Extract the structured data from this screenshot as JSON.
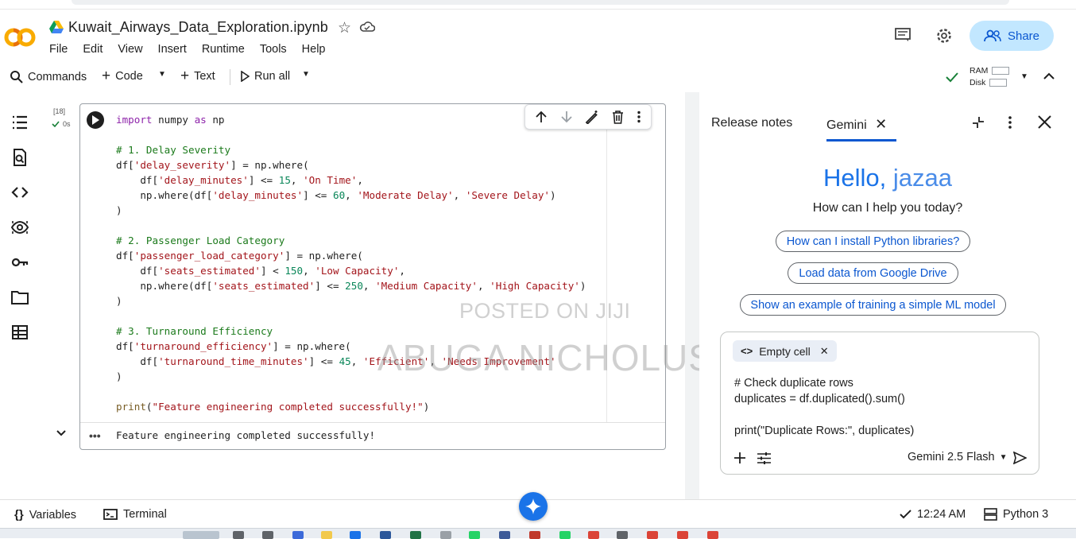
{
  "header": {
    "title": "Kuwait_Airways_Data_Exploration.ipynb",
    "menu": [
      "File",
      "Edit",
      "View",
      "Insert",
      "Runtime",
      "Tools",
      "Help"
    ],
    "share_label": "Share",
    "logo_text": "CO"
  },
  "toolbar": {
    "commands_label": "Commands",
    "code_label": "Code",
    "text_label": "Text",
    "run_all_label": "Run all",
    "ram_label": "RAM",
    "disk_label": "Disk"
  },
  "cell": {
    "exec_count": "[18]",
    "exec_time": "0s",
    "output": "Feature engineering completed successfully!",
    "output_dots": "•••"
  },
  "watermark": {
    "line1": "POSTED ON JIJI",
    "line2": "ABUGA NICHOLUS"
  },
  "panel": {
    "tab_release": "Release notes",
    "tab_gemini": "Gemini",
    "greeting_hello": "Hello,",
    "greeting_name": "jazaa",
    "help_question": "How can I help you today?",
    "suggestions": [
      "How can I install Python libraries?",
      "Load data from Google Drive",
      "Show an example of training a simple ML model"
    ],
    "context_chip": "Empty cell",
    "prompt_lines": [
      "# Check duplicate rows",
      "duplicates = df.duplicated().sum()",
      "",
      "print(\"Duplicate Rows:\", duplicates)"
    ],
    "model": "Gemini 2.5 Flash"
  },
  "status": {
    "variables_label": "Variables",
    "terminal_label": "Terminal",
    "time": "12:24 AM",
    "runtime": "Python 3"
  },
  "colors": {
    "accent": "#0b57d0",
    "share_bg": "#c2e7ff",
    "hello": "#1a73e8"
  }
}
